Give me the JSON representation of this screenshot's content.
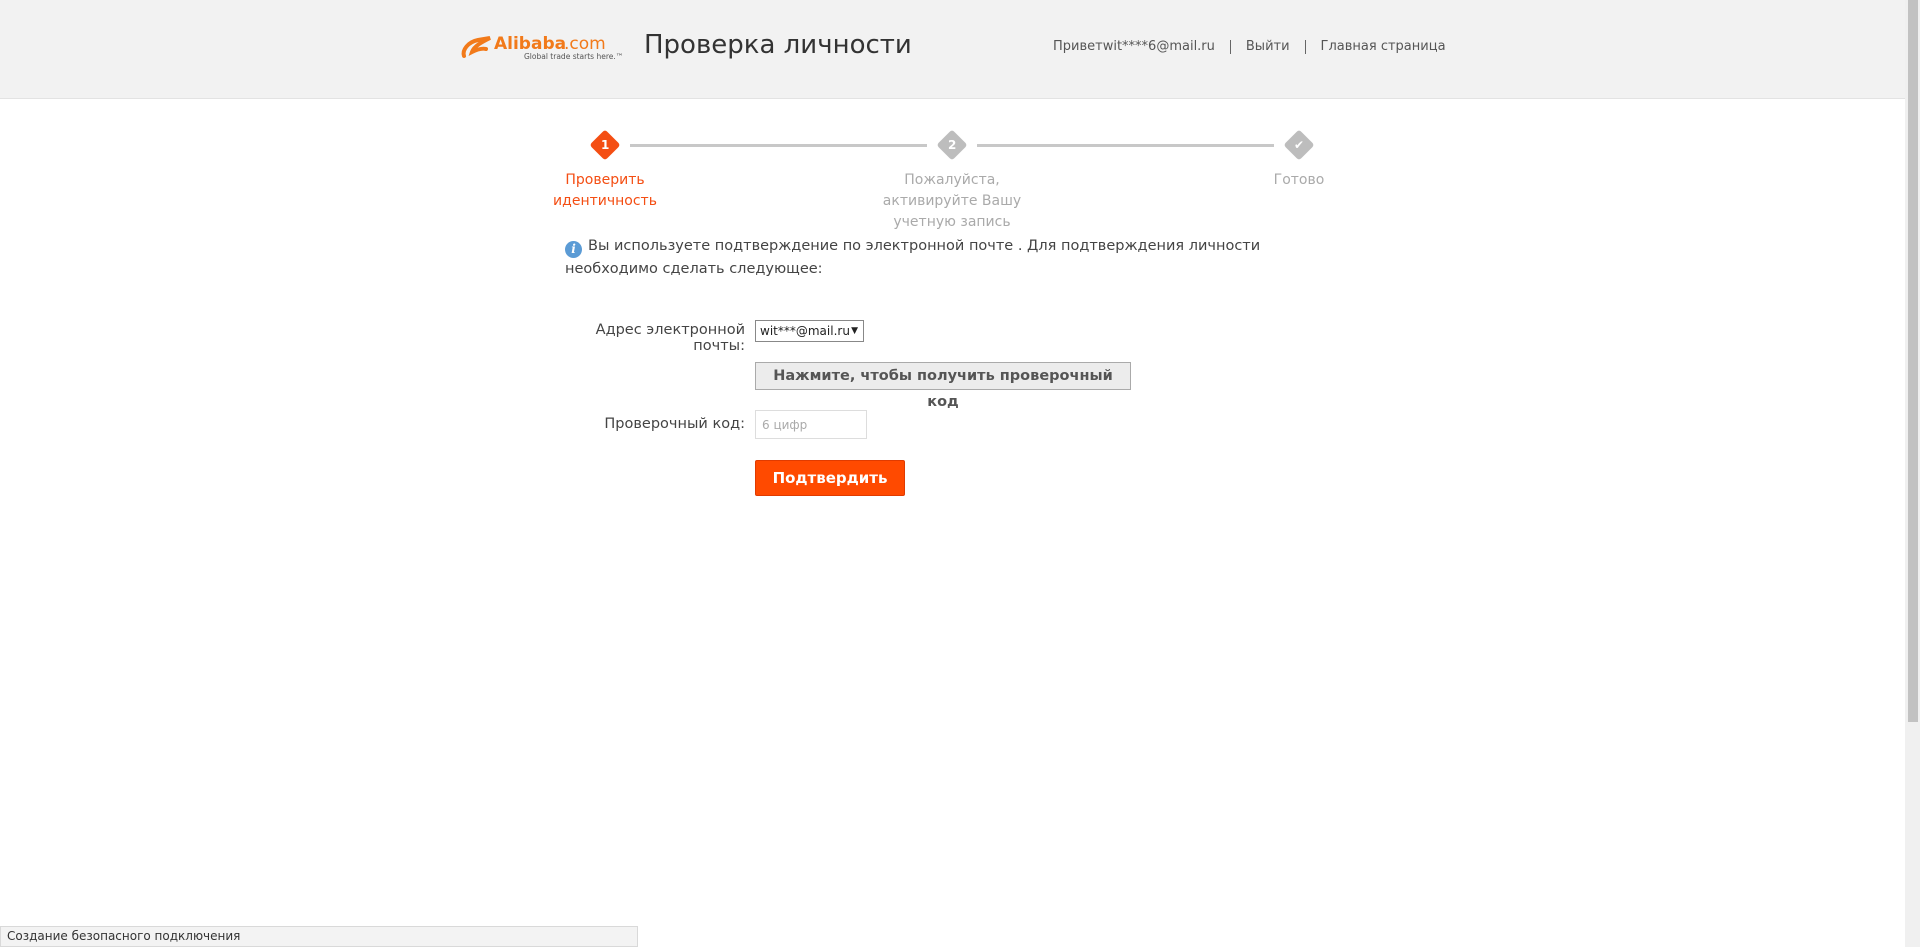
{
  "header": {
    "logo_text": "Alibaba.com",
    "logo_tagline": "Global trade starts here.™",
    "page_title": "Проверка личности",
    "greeting": "Приветwit****6@mail.ru",
    "logout": "Выйти",
    "home": "Главная страница"
  },
  "steps": [
    {
      "number": "1",
      "label_line1": "Проверить",
      "label_line2": "идентичность",
      "label_line3": "",
      "state": "active"
    },
    {
      "number": "2",
      "label_line1": "Пожалуйста,",
      "label_line2": "активируйте Вашу",
      "label_line3": "учетную запись",
      "state": "inactive"
    },
    {
      "number": "✔",
      "label_line1": "Готово",
      "label_line2": "",
      "label_line3": "",
      "state": "inactive"
    }
  ],
  "notice": {
    "text": "Вы используете подтверждение по электронной почте . Для подтверждения личности необходимо сделать следующее:"
  },
  "form": {
    "email_label": "Адрес электронной почты:",
    "email_value": "wit***@mail.ru",
    "get_code_label": "Нажмите, чтобы получить проверочный код",
    "code_label": "Проверочный код:",
    "code_placeholder": "6 цифр",
    "confirm_label": "Подтвердить"
  },
  "status_bar": {
    "text": "Создание безопасного подключения"
  },
  "colors": {
    "accent": "#ff4a00",
    "step_active": "#f44e13",
    "step_inactive": "#bdbdbd",
    "info": "#5b9bd5"
  }
}
